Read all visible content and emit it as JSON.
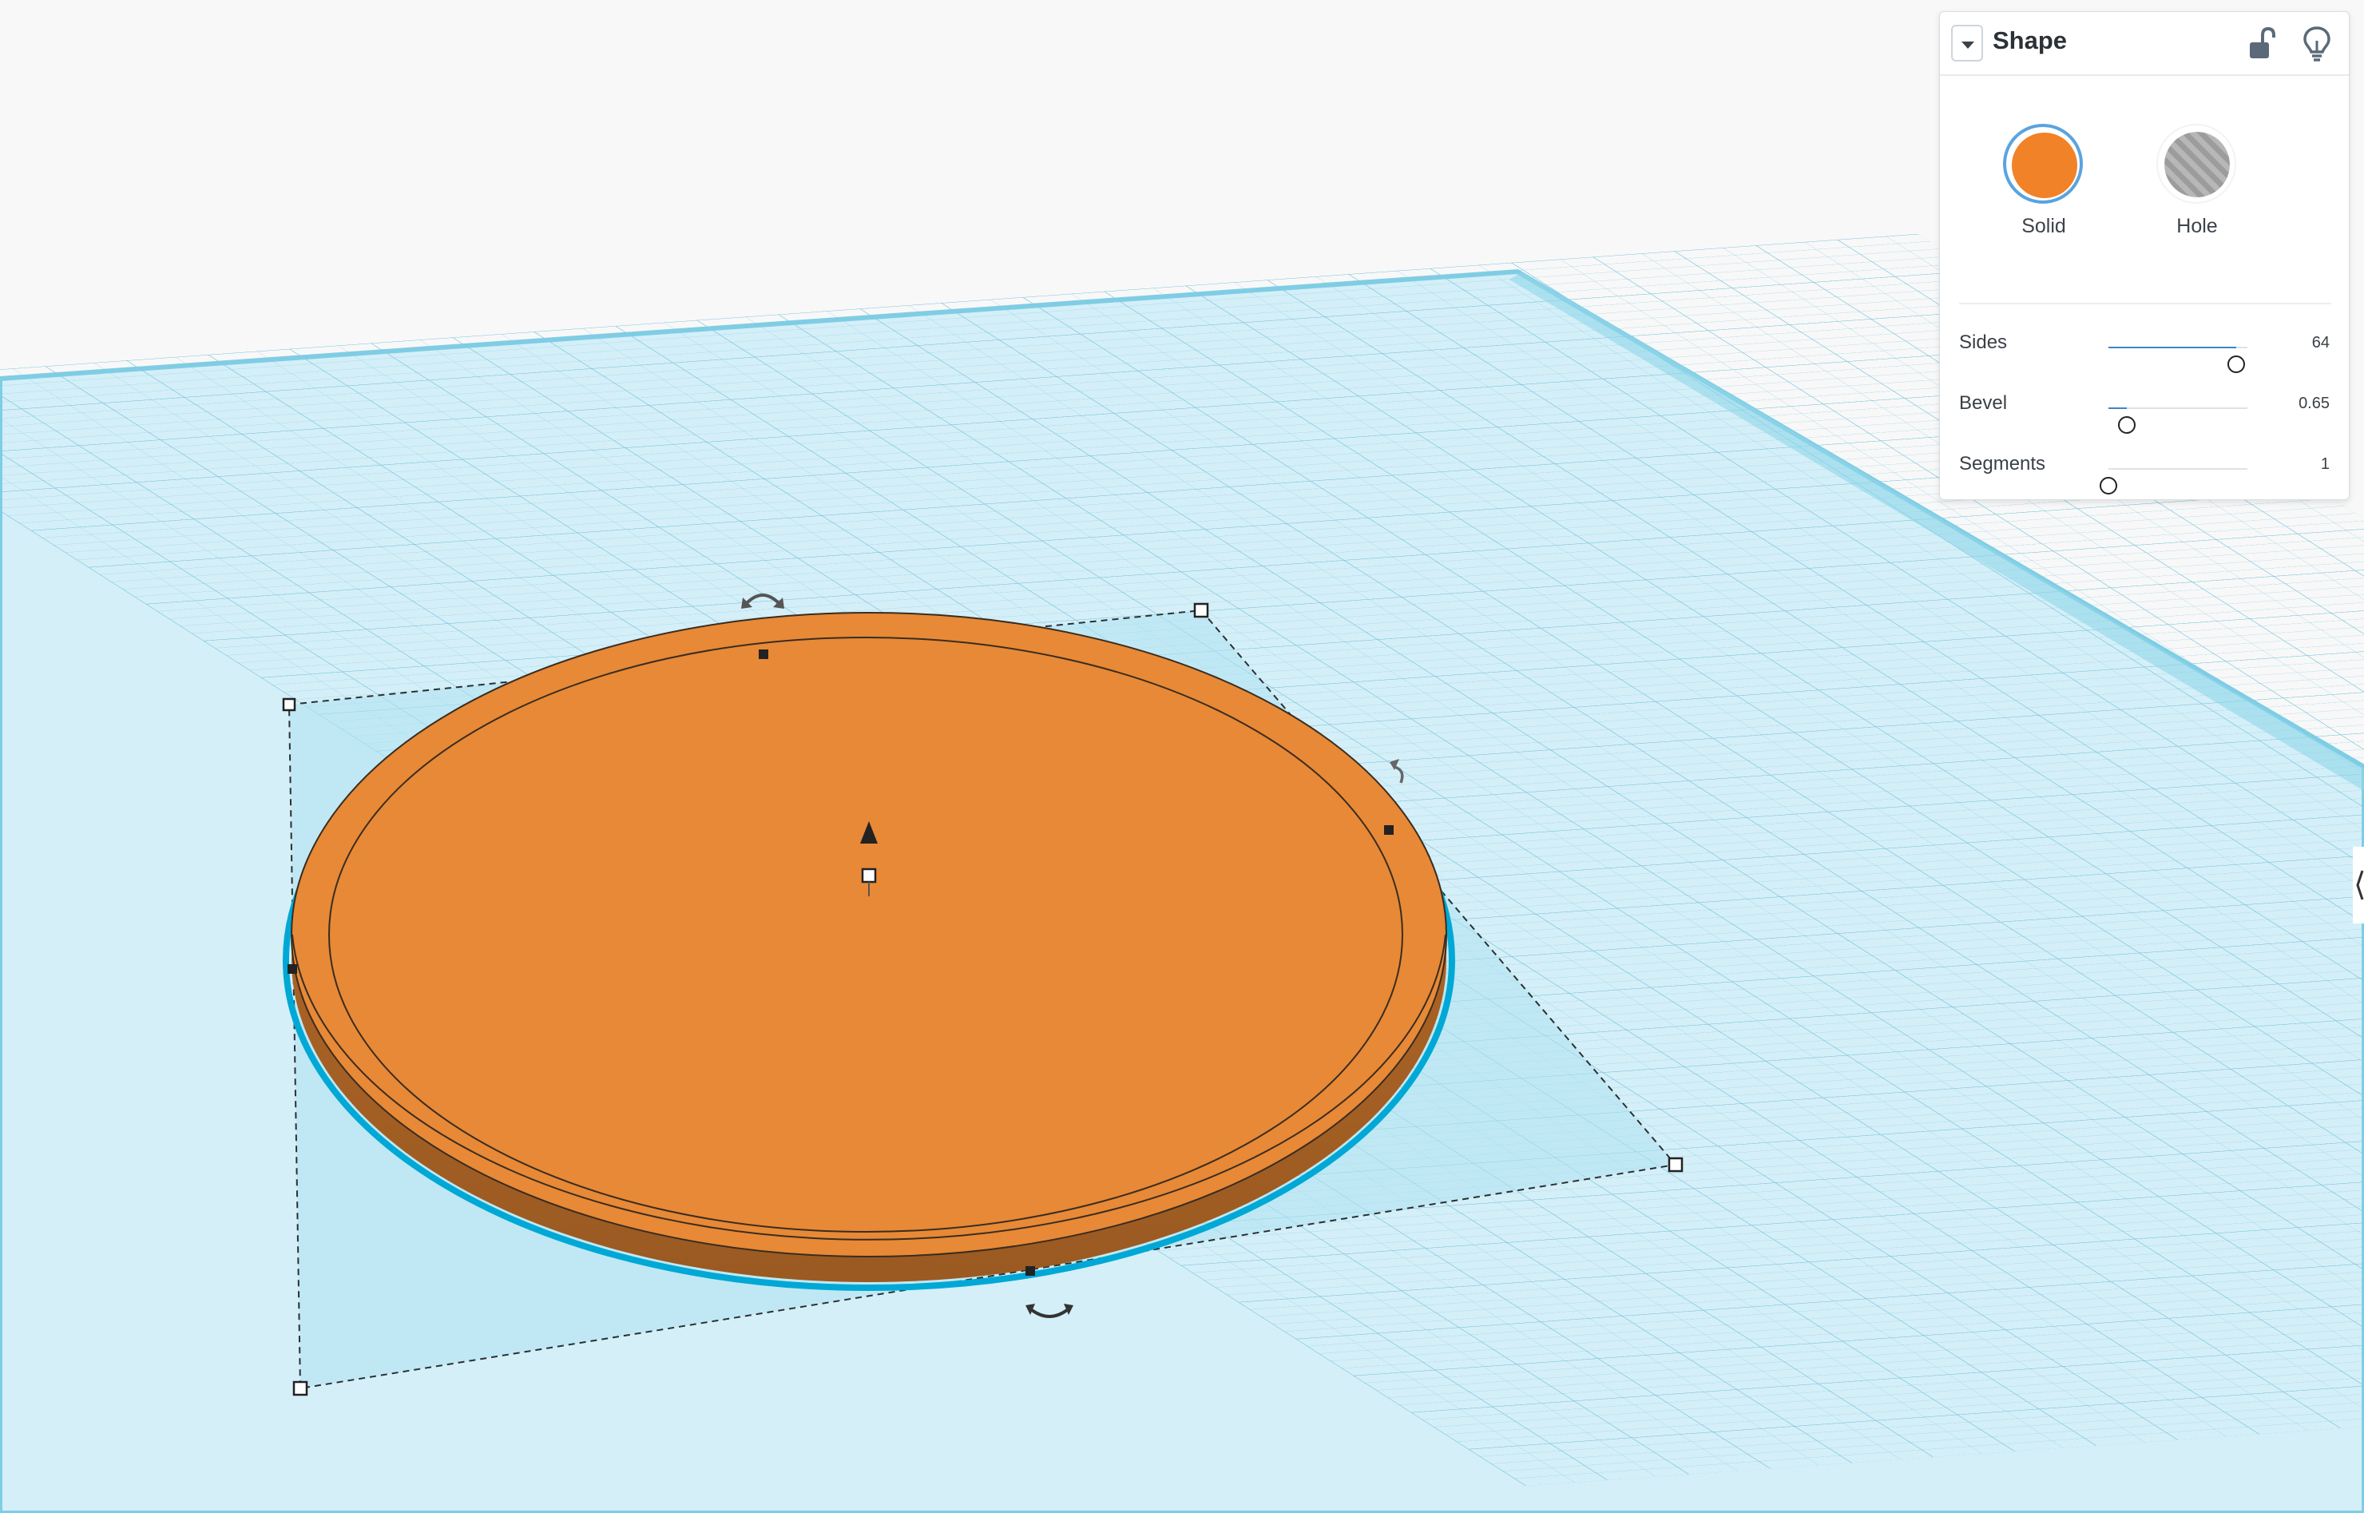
{
  "app": {
    "workplane_color": "#b9e3f2",
    "grid_line_color": "#7cc6de",
    "shape_color": "#e78936",
    "selection_color": "#00a8d6"
  },
  "panel": {
    "title": "Shape",
    "modes": [
      {
        "label": "Solid",
        "color": "#f28227",
        "selected": true
      },
      {
        "label": "Hole",
        "color": "#a9a9a9",
        "selected": false
      }
    ],
    "params": [
      {
        "label": "Sides",
        "value": "64",
        "fraction": 0.92
      },
      {
        "label": "Bevel",
        "value": "0.65",
        "fraction": 0.13
      },
      {
        "label": "Segments",
        "value": "1",
        "fraction": 0.0
      }
    ],
    "icons": {
      "lock": "unlock-icon",
      "hint": "lightbulb-icon",
      "toggle": "chevron-down-icon"
    }
  }
}
